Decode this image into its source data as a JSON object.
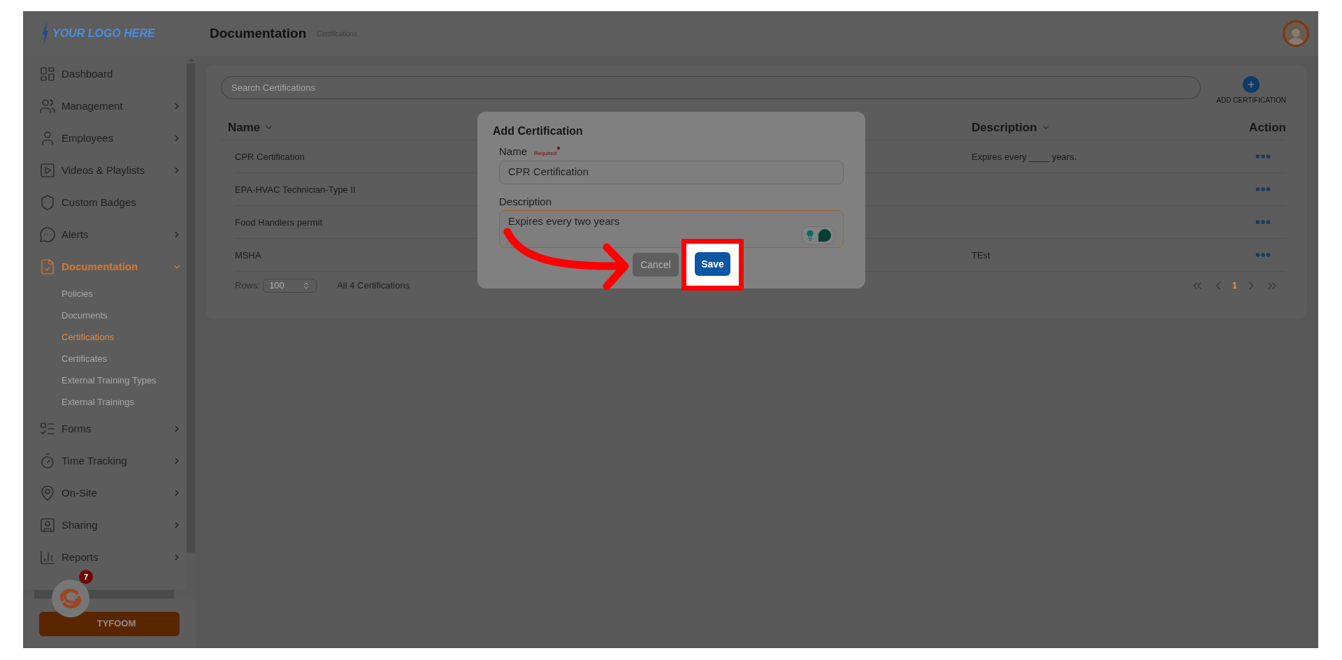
{
  "header": {
    "logo": "YOUR LOGO HERE",
    "title": "Documentation",
    "breadcrumb": "Certifications"
  },
  "sidebar": {
    "items": [
      {
        "label": "Dashboard",
        "has_submenu": false,
        "expanded": false,
        "selected": false
      },
      {
        "label": "Management",
        "has_submenu": true,
        "expanded": false,
        "selected": false
      },
      {
        "label": "Employees",
        "has_submenu": true,
        "expanded": false,
        "selected": false
      },
      {
        "label": "Videos & Playlists",
        "has_submenu": true,
        "expanded": false,
        "selected": false
      },
      {
        "label": "Custom Badges",
        "has_submenu": false,
        "expanded": false,
        "selected": false
      },
      {
        "label": "Alerts",
        "has_submenu": true,
        "expanded": false,
        "selected": false
      },
      {
        "label": "Documentation",
        "has_submenu": true,
        "expanded": true,
        "selected": true,
        "children": [
          {
            "label": "Policies",
            "selected": false
          },
          {
            "label": "Documents",
            "selected": false
          },
          {
            "label": "Certifications",
            "selected": true
          },
          {
            "label": "Certificates",
            "selected": false
          },
          {
            "label": "External Training Types",
            "selected": false
          },
          {
            "label": "External Trainings",
            "selected": false
          }
        ]
      },
      {
        "label": "Forms",
        "has_submenu": true,
        "expanded": false,
        "selected": false
      },
      {
        "label": "Time Tracking",
        "has_submenu": true,
        "expanded": false,
        "selected": false
      },
      {
        "label": "On-Site",
        "has_submenu": true,
        "expanded": false,
        "selected": false
      },
      {
        "label": "Sharing",
        "has_submenu": true,
        "expanded": false,
        "selected": false
      },
      {
        "label": "Reports",
        "has_submenu": true,
        "expanded": false,
        "selected": false
      }
    ],
    "brand_button": "TYFOOM",
    "notification_count": "7"
  },
  "search": {
    "placeholder": "Search Certifications"
  },
  "add_button": {
    "label": "ADD CERTIFICATION"
  },
  "table": {
    "columns": [
      {
        "label": "Name",
        "sortable": true
      },
      {
        "label": "Description",
        "sortable": true
      },
      {
        "label": "Action",
        "sortable": false
      }
    ],
    "rows": [
      {
        "name": "CPR Certification",
        "description": "Expires every ____ years."
      },
      {
        "name": "EPA-HVAC Technician-Type II"
      },
      {
        "name": "Food Handlers permit"
      },
      {
        "name": "MSHA",
        "description": "TEst"
      }
    ]
  },
  "footer": {
    "rows_label": "Rows:",
    "rows_value": "100",
    "total": "All 4 Certifications",
    "page": "1"
  },
  "dialog": {
    "title": "Add Certification",
    "fields": [
      {
        "kind": "input",
        "label": "Name",
        "required": "Required",
        "value": "CPR Certification",
        "focused": false
      },
      {
        "kind": "textarea",
        "label": "Description",
        "value": "Expires every two years",
        "focused": true
      }
    ],
    "buttons": [
      {
        "kind": "secondary",
        "label": "Cancel",
        "highlighted": false
      },
      {
        "kind": "primary",
        "label": "Save",
        "highlighted": true
      }
    ]
  }
}
